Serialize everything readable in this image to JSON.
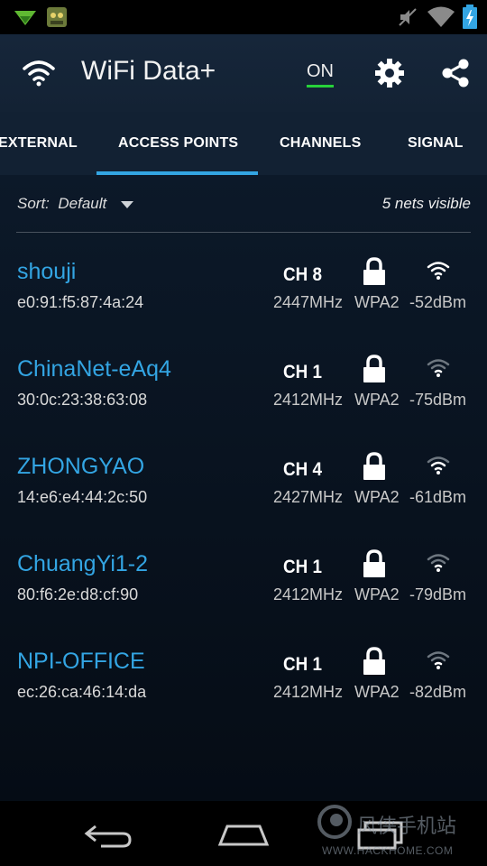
{
  "statusbar": {
    "icons": [
      "android-notification-icon",
      "game-notification-icon",
      "mute-icon",
      "wifi-icon",
      "battery-charging-icon"
    ]
  },
  "appbar": {
    "title": "WiFi Data+",
    "toggle_label": "ON",
    "icons": [
      "wifi-logo-icon",
      "settings-icon",
      "share-icon"
    ]
  },
  "tabs": [
    "EXTERNAL",
    "ACCESS POINTS",
    "CHANNELS",
    "SIGNAL"
  ],
  "active_tab": "ACCESS POINTS",
  "sort": {
    "label": "Sort:",
    "value": "Default"
  },
  "visible_count": "5 nets visible",
  "networks": [
    {
      "ssid": "shouji",
      "mac": "e0:91:f5:87:4a:24",
      "channel": "CH 8",
      "frequency": "2447MHz",
      "security": "WPA2",
      "signal": "-52dBm"
    },
    {
      "ssid": "ChinaNet-eAq4",
      "mac": "30:0c:23:38:63:08",
      "channel": "CH 1",
      "frequency": "2412MHz",
      "security": "WPA2",
      "signal": "-75dBm"
    },
    {
      "ssid": "ZHONGYAO",
      "mac": "14:e6:e4:44:2c:50",
      "channel": "CH 4",
      "frequency": "2427MHz",
      "security": "WPA2",
      "signal": "-61dBm"
    },
    {
      "ssid": "ChuangYi1-2",
      "mac": "80:f6:2e:d8:cf:90",
      "channel": "CH 1",
      "frequency": "2412MHz",
      "security": "WPA2",
      "signal": "-79dBm"
    },
    {
      "ssid": "NPI-OFFICE",
      "mac": "ec:26:ca:46:14:da",
      "channel": "CH 1",
      "frequency": "2412MHz",
      "security": "WPA2",
      "signal": "-82dBm"
    }
  ],
  "watermark": {
    "text": "风侠手机站",
    "url": "WWW.HACKHOME.COM"
  },
  "colors": {
    "accent": "#33a5e3",
    "toggle_on": "#27d13a"
  }
}
